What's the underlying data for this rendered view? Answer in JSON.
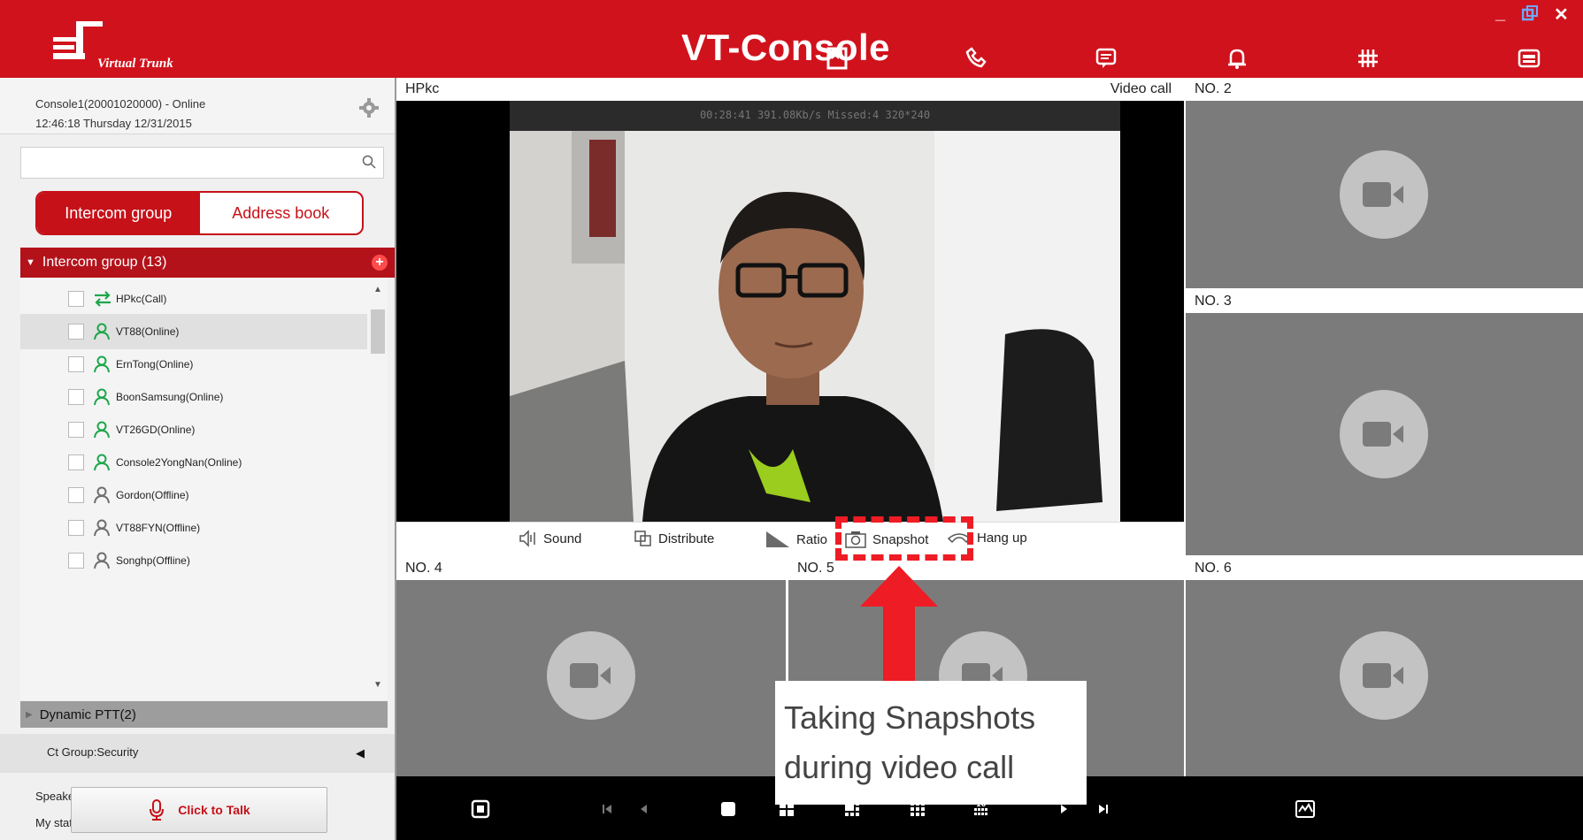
{
  "app": {
    "logo_text": "Virtual Trunk",
    "title": "VT-Console"
  },
  "header_icons": [
    "bookmark-icon",
    "phone-link-icon",
    "message-icon",
    "bell-icon",
    "grid-hash-icon",
    "printer-icon"
  ],
  "window_controls": {
    "minimize": "_",
    "restore": "restore-icon",
    "close": "✕"
  },
  "sidebar": {
    "status_line1": "Console1(20001020000) - Online",
    "status_line2": "12:46:18 Thursday 12/31/2015",
    "search": {
      "value": "",
      "placeholder": ""
    },
    "tabs": [
      {
        "label": "Intercom group"
      },
      {
        "label": "Address book"
      }
    ],
    "group_header": "Intercom group (13)",
    "group_add": "+",
    "members": [
      {
        "label": "HPkc(Call)",
        "status": "call"
      },
      {
        "label": "VT88(Online)",
        "status": "online"
      },
      {
        "label": "ErnTong(Online)",
        "status": "online"
      },
      {
        "label": "BoonSamsung(Online)",
        "status": "online"
      },
      {
        "label": "VT26GD(Online)",
        "status": "online"
      },
      {
        "label": "Console2YongNan(Online)",
        "status": "online"
      },
      {
        "label": "Gordon(Offline)",
        "status": "offline"
      },
      {
        "label": "VT88FYN(Offline)",
        "status": "offline"
      },
      {
        "label": "Songhp(Offline)",
        "status": "offline"
      }
    ],
    "dynamic_ptt": "Dynamic PTT(2)",
    "ct_group": "Ct Group:Security",
    "speaker": "Speaker:",
    "my_status": "My status:Close",
    "talk_button": "Click to Talk"
  },
  "main_video": {
    "name": "HPkc",
    "type": "Video call",
    "stats": "00:28:41  391.08Kb/s Missed:4 320*240",
    "controls": {
      "sound": "Sound",
      "distribute": "Distribute",
      "ratio": "Ratio",
      "snapshot": "Snapshot",
      "hangup": "Hang up"
    }
  },
  "cells": {
    "no2": "NO. 2",
    "no3": "NO. 3",
    "no4": "NO. 4",
    "no5": "NO. 5",
    "no6": "NO. 6"
  },
  "toolbar_icons": [
    "window-icon",
    "first-page-icon",
    "prev-icon",
    "layout-1-icon",
    "layout-4-icon",
    "layout-6-icon",
    "layout-9-icon",
    "layout-16-icon",
    "next-icon",
    "last-page-icon",
    "map-icon"
  ],
  "annotation": {
    "line1": "Taking Snapshots",
    "line2": "during video call"
  },
  "colors": {
    "brand_red": "#d0121c",
    "online_green": "#1fa64a",
    "annotation_red": "#ee1c24"
  }
}
